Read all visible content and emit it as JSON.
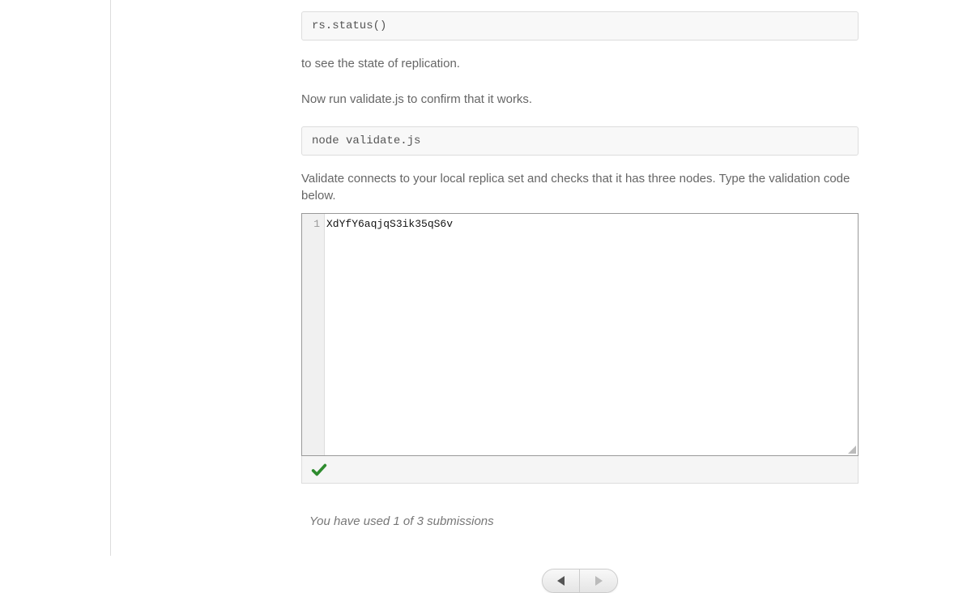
{
  "code_blocks": {
    "status": "rs.status()",
    "validate": "node validate.js"
  },
  "paragraphs": {
    "replication_state": "to see the state of replication.",
    "run_validate": "Now run validate.js to confirm that it works.",
    "validate_info": "Validate connects to your local replica set and checks that it has three nodes. Type the validation code below."
  },
  "editor": {
    "line_number": "1",
    "value": "XdYfY6aqjqS3ik35qS6v"
  },
  "status": {
    "correct": true
  },
  "submissions": "You have used 1 of 3 submissions"
}
